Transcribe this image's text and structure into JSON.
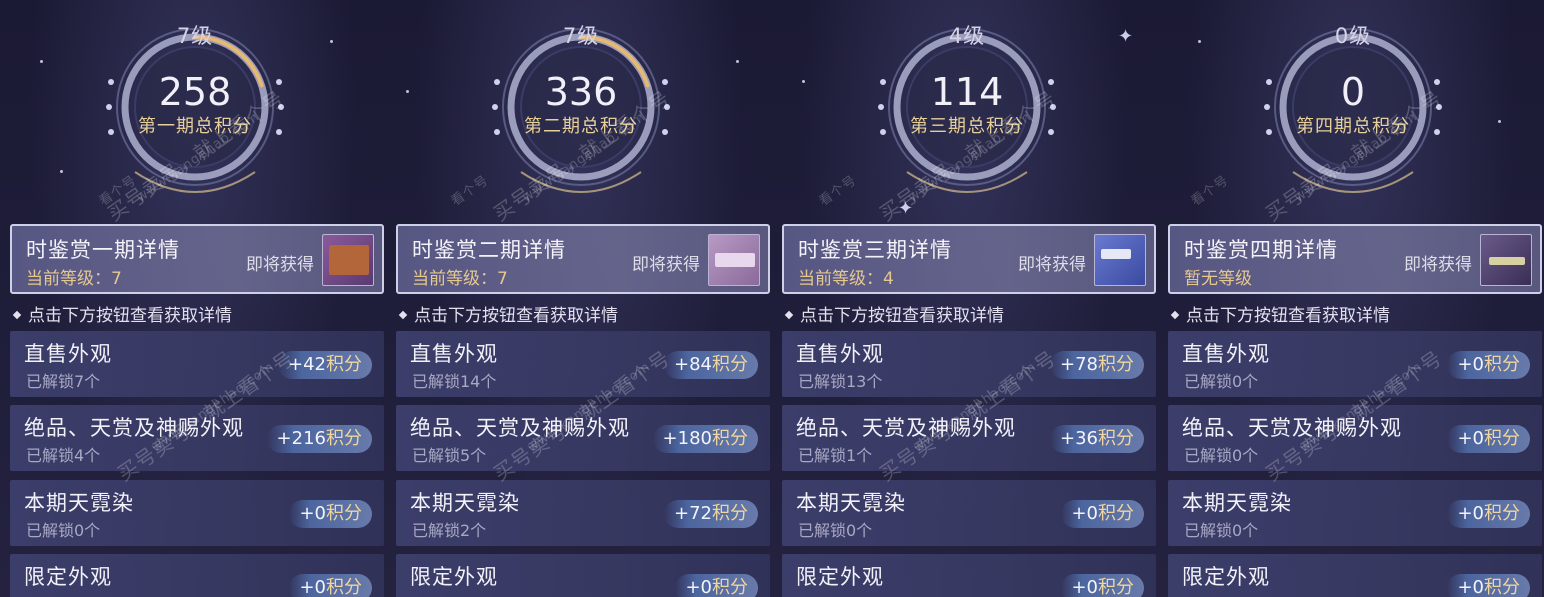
{
  "panels": [
    {
      "level": "7级",
      "score": "258",
      "score_label": "第一期总积分",
      "progress": 0.2,
      "detail_title": "时鉴赏一期详情",
      "detail_sub": "当前等级：7",
      "upcoming": "即将获得",
      "thumb_color": "#b2663a",
      "rows": [
        {
          "title": "直售外观",
          "sub": "已解锁7个",
          "points": "+42",
          "unit": "积分"
        },
        {
          "title": "绝品、天赏及神赐外观",
          "sub": "已解锁4个",
          "points": "+216",
          "unit": "积分"
        },
        {
          "title": "本期天霓染",
          "sub": "已解锁0个",
          "points": "+0",
          "unit": "积分"
        },
        {
          "title": "限定外观",
          "sub": "",
          "points": "+0",
          "unit": "积分"
        }
      ]
    },
    {
      "level": "7级",
      "score": "336",
      "score_label": "第二期总积分",
      "progress": 0.2,
      "detail_title": "时鉴赏二期详情",
      "detail_sub": "当前等级：7",
      "upcoming": "即将获得",
      "thumb_color": "#8a6a9a",
      "rows": [
        {
          "title": "直售外观",
          "sub": "已解锁14个",
          "points": "+84",
          "unit": "积分"
        },
        {
          "title": "绝品、天赏及神赐外观",
          "sub": "已解锁5个",
          "points": "+180",
          "unit": "积分"
        },
        {
          "title": "本期天霓染",
          "sub": "已解锁2个",
          "points": "+72",
          "unit": "积分"
        },
        {
          "title": "限定外观",
          "sub": "",
          "points": "+0",
          "unit": "积分"
        }
      ]
    },
    {
      "level": "4级",
      "score": "114",
      "score_label": "第三期总积分",
      "progress": 0.0,
      "detail_title": "时鉴赏三期详情",
      "detail_sub": "当前等级：4",
      "upcoming": "即将获得",
      "thumb_color": "#4a5aa8",
      "rows": [
        {
          "title": "直售外观",
          "sub": "已解锁13个",
          "points": "+78",
          "unit": "积分"
        },
        {
          "title": "绝品、天赏及神赐外观",
          "sub": "已解锁1个",
          "points": "+36",
          "unit": "积分"
        },
        {
          "title": "本期天霓染",
          "sub": "已解锁0个",
          "points": "+0",
          "unit": "积分"
        },
        {
          "title": "限定外观",
          "sub": "",
          "points": "+0",
          "unit": "积分"
        }
      ]
    },
    {
      "level": "0级",
      "score": "0",
      "score_label": "第四期总积分",
      "progress": 0.0,
      "detail_title": "时鉴赏四期详情",
      "detail_sub": "暂无等级",
      "upcoming": "即将获得",
      "thumb_color": "#5a4a7a",
      "rows": [
        {
          "title": "直售外观",
          "sub": "已解锁0个",
          "points": "+0",
          "unit": "积分"
        },
        {
          "title": "绝品、天赏及神赐外观",
          "sub": "已解锁0个",
          "points": "+0",
          "unit": "积分"
        },
        {
          "title": "本期天霓染",
          "sub": "已解锁0个",
          "points": "+0",
          "unit": "积分"
        },
        {
          "title": "限定外观",
          "sub": "",
          "points": "+0",
          "unit": "积分"
        }
      ]
    }
  ],
  "hint": "点击下方按钮查看获取详情",
  "watermark_main": "买号卖号，就上看个号",
  "watermark_site": "www.kangehao.com",
  "watermark_brand": "看个号"
}
